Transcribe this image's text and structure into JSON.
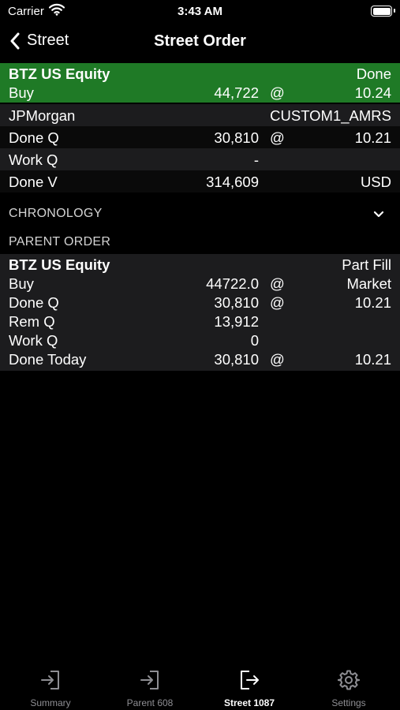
{
  "status_bar": {
    "carrier": "Carrier",
    "time": "3:43 AM"
  },
  "nav": {
    "back_label": "Street",
    "title": "Street Order"
  },
  "order": {
    "symbol": "BTZ US Equity",
    "status": "Done",
    "side": "Buy",
    "quantity": "44,722",
    "at": "@",
    "price": "10.24",
    "rows": [
      {
        "label": "JPMorgan",
        "value": "",
        "at": "",
        "right": "CUSTOM1_AMRS"
      },
      {
        "label": "Done Q",
        "value": "30,810",
        "at": "@",
        "right": "10.21"
      },
      {
        "label": "Work Q",
        "value": "-",
        "at": "",
        "right": ""
      },
      {
        "label": "Done V",
        "value": "314,609",
        "at": "",
        "right": "USD"
      }
    ]
  },
  "sections": {
    "chronology": "CHRONOLOGY",
    "parent_order": "PARENT ORDER"
  },
  "parent": {
    "symbol": "BTZ US Equity",
    "status": "Part Fill",
    "rows": [
      {
        "label": "Buy",
        "value": "44722.0",
        "at": "@",
        "right": "Market"
      },
      {
        "label": "Done Q",
        "value": "30,810",
        "at": "@",
        "right": "10.21"
      },
      {
        "label": "Rem Q",
        "value": "13,912",
        "at": "",
        "right": ""
      },
      {
        "label": "Work Q",
        "value": "0",
        "at": "",
        "right": ""
      },
      {
        "label": "Done Today",
        "value": "30,810",
        "at": "@",
        "right": "10.21"
      }
    ]
  },
  "tabs": [
    {
      "label": "Summary",
      "icon": "arrow-in-icon",
      "active": false
    },
    {
      "label": "Parent 608",
      "icon": "arrow-in-icon",
      "active": false
    },
    {
      "label": "Street 1087",
      "icon": "arrow-out-icon",
      "active": true
    },
    {
      "label": "Settings",
      "icon": "gear-icon",
      "active": false
    }
  ],
  "colors": {
    "header_green": "#1f7a26",
    "row_dark": "#1c1c1e",
    "inactive_tab": "#8e8e93"
  }
}
